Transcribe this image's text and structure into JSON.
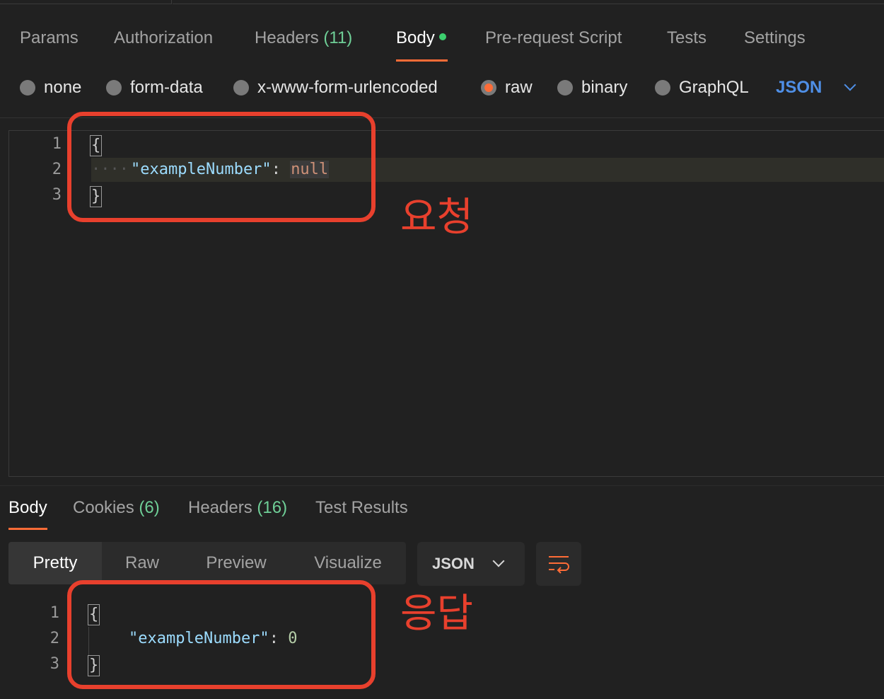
{
  "request_tabs": {
    "params": "Params",
    "authorization": "Authorization",
    "headers": "Headers",
    "headers_count": "(11)",
    "body": "Body",
    "prerequest": "Pre-request Script",
    "tests": "Tests",
    "settings": "Settings"
  },
  "body_modes": {
    "none": "none",
    "form_data": "form-data",
    "urlencoded": "x-www-form-urlencoded",
    "raw": "raw",
    "binary": "binary",
    "graphql": "GraphQL",
    "format": "JSON",
    "selected": "raw"
  },
  "request_editor": {
    "line_numbers": [
      "1",
      "2",
      "3"
    ],
    "open_brace": "{",
    "key": "\"exampleNumber\"",
    "colon": ": ",
    "value": "null",
    "close_brace": "}",
    "indent_guide": "····"
  },
  "response_tabs": {
    "body": "Body",
    "cookies": "Cookies",
    "cookies_count": "(6)",
    "headers": "Headers",
    "headers_count": "(16)",
    "test_results": "Test Results"
  },
  "response_view": {
    "pretty": "Pretty",
    "raw": "Raw",
    "preview": "Preview",
    "visualize": "Visualize",
    "format": "JSON"
  },
  "response_editor": {
    "line_numbers": [
      "1",
      "2",
      "3"
    ],
    "open_brace": "{",
    "key": "\"exampleNumber\"",
    "colon": ": ",
    "value": "0",
    "close_brace": "}"
  },
  "annotations": {
    "request_label": "요청",
    "response_label": "응답",
    "color": "#e8402d"
  },
  "colors": {
    "accent": "#ff6c37",
    "count_green": "#6fcf97",
    "format_blue": "#4f8fe6"
  },
  "icons": {
    "wrap": "wrap-lines-icon",
    "chevron": "chevron-down-icon"
  }
}
